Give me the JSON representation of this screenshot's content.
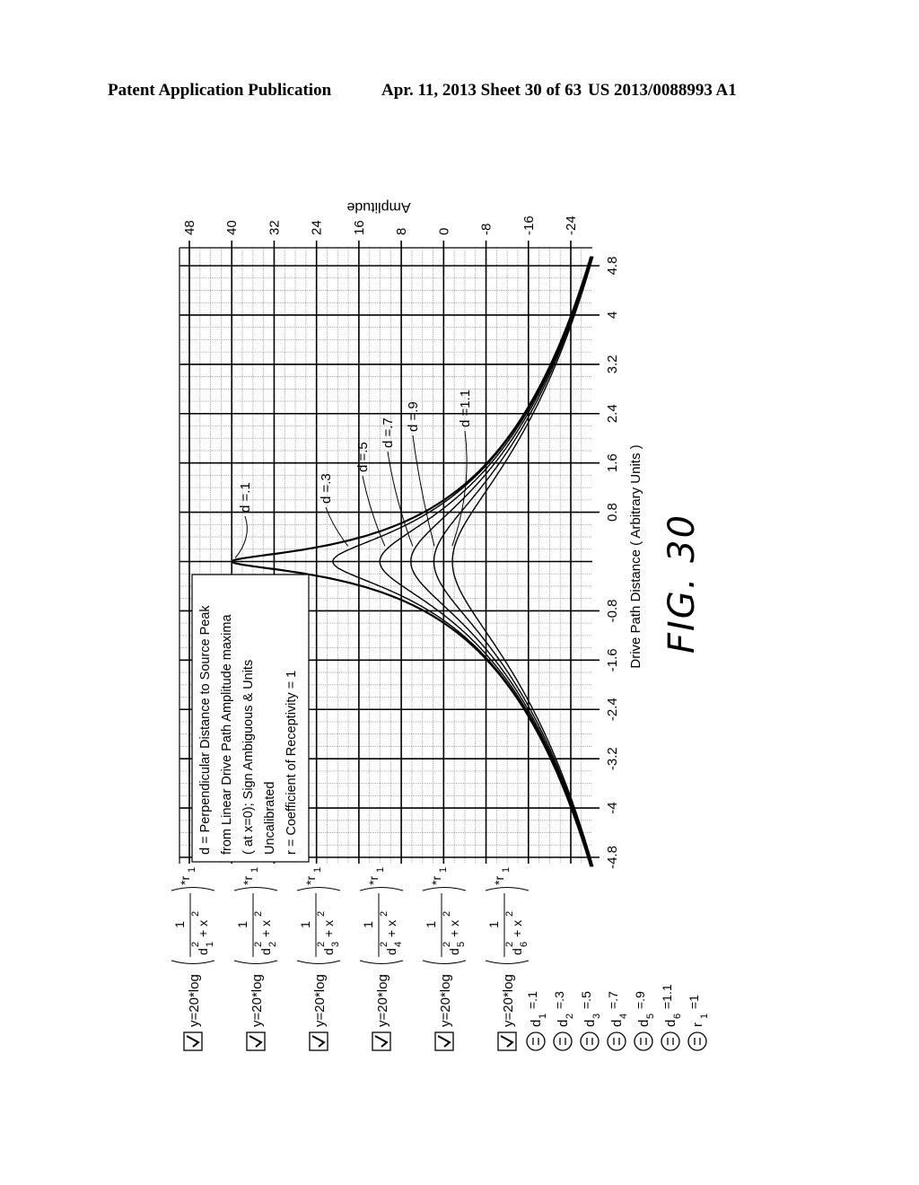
{
  "header": {
    "left": "Patent Application Publication",
    "middle": "Apr. 11, 2013  Sheet 30 of 63",
    "right": "US 2013/0088993 A1"
  },
  "figure_label": "FIG. 30",
  "chart_data": {
    "type": "line",
    "orientation": "rotated 90° counter-clockwise on page",
    "title": "",
    "xlabel": "Drive Path Distance  ( Arbitrary Units )",
    "ylabel": "Amplitude",
    "xlim": [
      -4.8,
      4.8
    ],
    "ylim": [
      -24,
      48
    ],
    "x_ticks": [
      "-4.8",
      "-4",
      "-3.2",
      "-2.4",
      "-1.6",
      "-0.8",
      "0.8",
      "1.6",
      "2.4",
      "3.2",
      "4",
      "4.8"
    ],
    "y_ticks": [
      "48",
      "40",
      "32",
      "24",
      "16",
      "8",
      "0",
      "-8",
      "-16",
      "-24"
    ],
    "grid": true,
    "formula": "y = 20*log(1/(d^2 + x^2))*r",
    "series": [
      {
        "name": "d =.1",
        "d": 0.1,
        "peak": 40.0
      },
      {
        "name": "d =.3",
        "d": 0.3,
        "peak": 20.9
      },
      {
        "name": "d =.5",
        "d": 0.5,
        "peak": 12.0
      },
      {
        "name": "d =.7",
        "d": 0.7,
        "peak": 6.2
      },
      {
        "name": "d =.9",
        "d": 0.9,
        "peak": 1.8
      },
      {
        "name": "d =1.1",
        "d": 1.1,
        "peak": -1.7
      }
    ],
    "annotation_box": [
      "d = Perpendicular Distance to Source Peak",
      "from Linear Drive Path Amplitude maxima",
      "  ( at x=0);  Sign Ambiguous & Units",
      "Uncalibrated",
      "r = Coefficient of Receptivity = 1"
    ]
  },
  "equations": [
    {
      "checked": true,
      "prefix": "y=20*log",
      "num": "1",
      "den_sub": "1",
      "suffix": "r",
      "suffix_sub": "1"
    },
    {
      "checked": true,
      "prefix": "y=20*log",
      "num": "1",
      "den_sub": "2",
      "suffix": "r",
      "suffix_sub": "1"
    },
    {
      "checked": true,
      "prefix": "y=20*log",
      "num": "1",
      "den_sub": "3",
      "suffix": "r",
      "suffix_sub": "1"
    },
    {
      "checked": true,
      "prefix": "y=20*log",
      "num": "1",
      "den_sub": "4",
      "suffix": "r",
      "suffix_sub": "1"
    },
    {
      "checked": true,
      "prefix": "y=20*log",
      "num": "1",
      "den_sub": "5",
      "suffix": "r",
      "suffix_sub": "1"
    },
    {
      "checked": true,
      "prefix": "y=20*log",
      "num": "1",
      "den_sub": "6",
      "suffix": "r",
      "suffix_sub": "1"
    }
  ],
  "definitions": [
    {
      "var": "d",
      "sub": "1",
      "value": "=.1"
    },
    {
      "var": "d",
      "sub": "2",
      "value": "=.3"
    },
    {
      "var": "d",
      "sub": "3",
      "value": "=.5"
    },
    {
      "var": "d",
      "sub": "4",
      "value": "=.7"
    },
    {
      "var": "d",
      "sub": "5",
      "value": "=.9"
    },
    {
      "var": "d",
      "sub": "6",
      "value": "=1.1"
    },
    {
      "var": "r",
      "sub": "1",
      "value": "=1"
    }
  ]
}
